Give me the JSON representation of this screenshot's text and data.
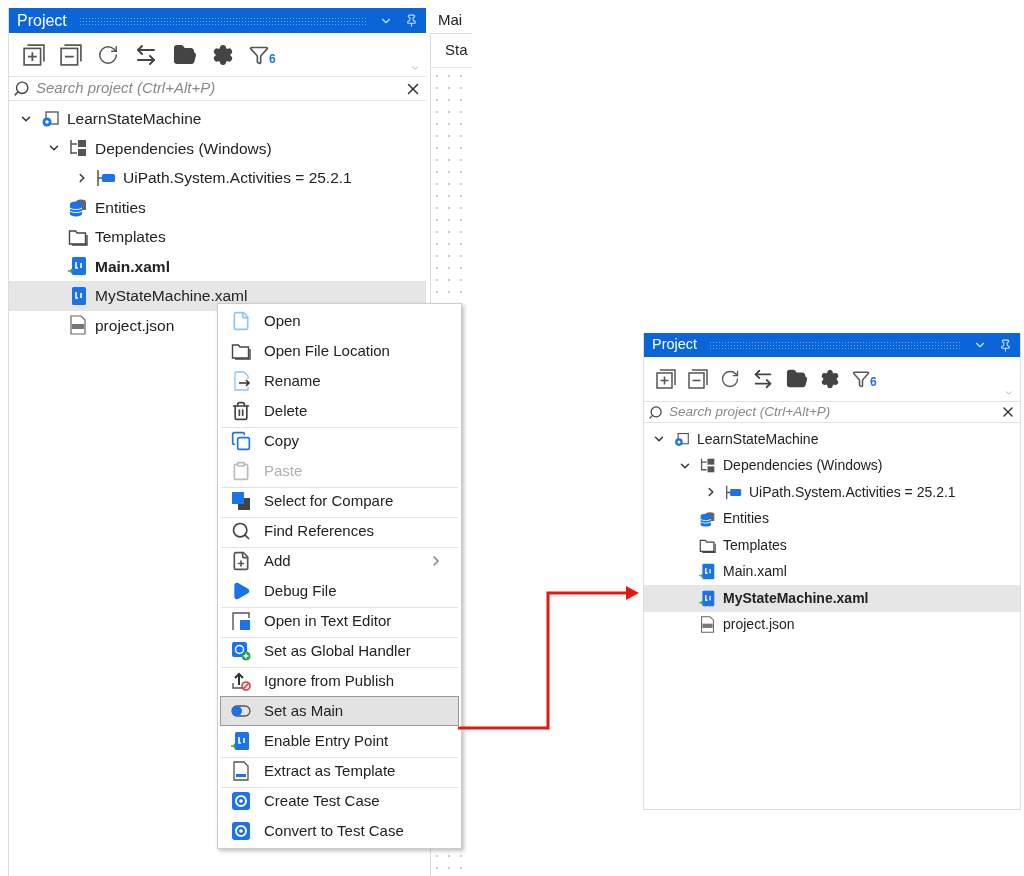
{
  "before": {
    "panel": {
      "title": "Project",
      "filter_count": "6",
      "search": {
        "placeholder": "Search project (Ctrl+Alt+P)"
      },
      "tree": [
        {
          "label": "LearnStateMachine",
          "kind": "project",
          "bold": false,
          "selected": false,
          "expanded": true,
          "children": [
            {
              "label": "Dependencies (Windows)",
              "kind": "dependencies",
              "bold": false,
              "selected": false,
              "expanded": true,
              "children": [
                {
                  "label": "UiPath.System.Activities = 25.2.1",
                  "kind": "package",
                  "bold": false,
                  "selected": false,
                  "expanded": false
                }
              ]
            },
            {
              "label": "Entities",
              "kind": "database",
              "bold": false,
              "selected": false
            },
            {
              "label": "Templates",
              "kind": "folder",
              "bold": false,
              "selected": false
            },
            {
              "label": "Main.xaml",
              "kind": "xaml_entry",
              "bold": true,
              "selected": false
            },
            {
              "label": "MyStateMachine.xaml",
              "kind": "xaml",
              "bold": false,
              "selected": true
            },
            {
              "label": "project.json",
              "kind": "json",
              "bold": false,
              "selected": false
            }
          ]
        }
      ]
    },
    "editor": {
      "tab": "Mai",
      "subtab": "Sta"
    },
    "context_menu": [
      {
        "label": "Open",
        "kind": "file",
        "disabled": false,
        "selected": false,
        "submenu": false,
        "separator_above": false
      },
      {
        "label": "Open File Location",
        "kind": "folder",
        "disabled": false,
        "selected": false,
        "submenu": false,
        "separator_above": false
      },
      {
        "label": "Rename",
        "kind": "rename",
        "disabled": false,
        "selected": false,
        "submenu": false,
        "separator_above": false
      },
      {
        "label": "Delete",
        "kind": "trash",
        "disabled": false,
        "selected": false,
        "submenu": false,
        "separator_above": false
      },
      {
        "label": "Copy",
        "kind": "copy",
        "disabled": false,
        "selected": false,
        "submenu": false,
        "separator_above": true
      },
      {
        "label": "Paste",
        "kind": "paste",
        "disabled": true,
        "selected": false,
        "submenu": false,
        "separator_above": false
      },
      {
        "label": "Select for Compare",
        "kind": "compare",
        "disabled": false,
        "selected": false,
        "submenu": false,
        "separator_above": true
      },
      {
        "label": "Find References",
        "kind": "search",
        "disabled": false,
        "selected": false,
        "submenu": false,
        "separator_above": true
      },
      {
        "label": "Add",
        "kind": "add",
        "disabled": false,
        "selected": false,
        "submenu": true,
        "separator_above": true
      },
      {
        "label": "Debug File",
        "kind": "play",
        "disabled": false,
        "selected": false,
        "submenu": false,
        "separator_above": false
      },
      {
        "label": "Open in Text Editor",
        "kind": "text_editor",
        "disabled": false,
        "selected": false,
        "submenu": false,
        "separator_above": true
      },
      {
        "label": "Set as Global Handler",
        "kind": "handler",
        "disabled": false,
        "selected": false,
        "submenu": false,
        "separator_above": true
      },
      {
        "label": "Ignore from Publish",
        "kind": "ignore",
        "disabled": false,
        "selected": false,
        "submenu": false,
        "separator_above": true
      },
      {
        "label": "Set as Main",
        "kind": "toggle",
        "disabled": false,
        "selected": true,
        "submenu": false,
        "separator_above": true
      },
      {
        "label": "Enable Entry Point",
        "kind": "xaml_entry",
        "disabled": false,
        "selected": false,
        "submenu": false,
        "separator_above": false
      },
      {
        "label": "Extract as Template",
        "kind": "template",
        "disabled": false,
        "selected": false,
        "submenu": false,
        "separator_above": true
      },
      {
        "label": "Create Test Case",
        "kind": "test",
        "disabled": false,
        "selected": false,
        "submenu": false,
        "separator_above": true
      },
      {
        "label": "Convert to Test Case",
        "kind": "test",
        "disabled": false,
        "selected": false,
        "submenu": false,
        "separator_above": false
      }
    ]
  },
  "after": {
    "panel": {
      "title": "Project",
      "filter_count": "6",
      "search": {
        "placeholder": "Search project (Ctrl+Alt+P)"
      },
      "tree": [
        {
          "label": "LearnStateMachine",
          "kind": "project",
          "bold": false,
          "selected": false,
          "expanded": true,
          "children": [
            {
              "label": "Dependencies (Windows)",
              "kind": "dependencies",
              "bold": false,
              "selected": false,
              "expanded": true,
              "children": [
                {
                  "label": "UiPath.System.Activities = 25.2.1",
                  "kind": "package",
                  "bold": false,
                  "selected": false,
                  "expanded": false
                }
              ]
            },
            {
              "label": "Entities",
              "kind": "database",
              "bold": false,
              "selected": false
            },
            {
              "label": "Templates",
              "kind": "folder",
              "bold": false,
              "selected": false
            },
            {
              "label": "Main.xaml",
              "kind": "xaml_entry",
              "bold": false,
              "selected": false
            },
            {
              "label": "MyStateMachine.xaml",
              "kind": "xaml_entry",
              "bold": true,
              "selected": true
            },
            {
              "label": "project.json",
              "kind": "json",
              "bold": false,
              "selected": false
            }
          ]
        }
      ]
    }
  }
}
